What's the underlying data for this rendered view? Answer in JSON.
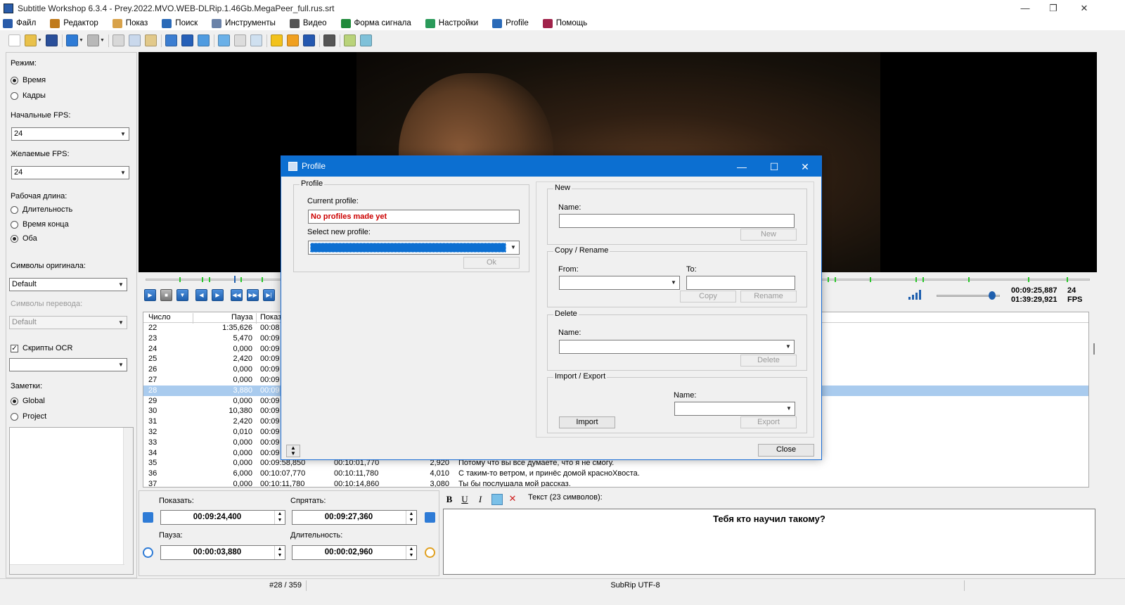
{
  "window": {
    "title": "Subtitle Workshop 6.3.4 - Prey.2022.MVO.WEB-DLRip.1.46Gb.MegaPeer_full.rus.srt",
    "minimize": "—",
    "maximize": "❐",
    "close": "✕"
  },
  "menu": [
    {
      "label": "Файл",
      "icon": "file-icon",
      "color": "#2a5caa"
    },
    {
      "label": "Редактор",
      "icon": "edit-icon",
      "color": "#c07a1a"
    },
    {
      "label": "Показ",
      "icon": "eye-icon",
      "color": "#d8a24a"
    },
    {
      "label": "Поиск",
      "icon": "search-icon",
      "color": "#2a6ab8"
    },
    {
      "label": "Инструменты",
      "icon": "tools-icon",
      "color": "#6a82a8"
    },
    {
      "label": "Видео",
      "icon": "film-icon",
      "color": "#555555"
    },
    {
      "label": "Форма сигнала",
      "icon": "waveform-icon",
      "color": "#1f8a3a"
    },
    {
      "label": "Настройки",
      "icon": "settings-icon",
      "color": "#2a9a5a"
    },
    {
      "label": "Profile",
      "icon": "profile-icon",
      "color": "#2a6ab8"
    },
    {
      "label": "Помощь",
      "icon": "help-book-icon",
      "color": "#a0224a"
    }
  ],
  "left": {
    "mode_label": "Режим:",
    "mode_time": "Время",
    "mode_frames": "Кадры",
    "input_fps_label": "Начальные FPS:",
    "input_fps": "24",
    "target_fps_label": "Желаемые FPS:",
    "target_fps": "24",
    "work_length_label": "Рабочая длина:",
    "wl_duration": "Длительность",
    "wl_end_time": "Время конца",
    "wl_both": "Оба",
    "charset_orig_label": "Символы оригинала:",
    "charset_orig": "Default",
    "charset_trans_label": "Символы перевода:",
    "charset_trans": "Default",
    "ocr_label": "Скрипты OCR",
    "ocr_value": "",
    "notes_label": "Заметки:",
    "notes_global": "Global",
    "notes_project": "Project"
  },
  "player": {
    "current_time": "00:09:25,887",
    "total_time": "01:39:29,921",
    "fps_value": "24",
    "fps_unit": "FPS",
    "volume": 0.88
  },
  "table": {
    "headers": {
      "num": "Число",
      "pause": "Пауза",
      "show": "Показ"
    },
    "rows": [
      {
        "num": "22",
        "pause": "1:35,626",
        "show": "00:08",
        "hide": "",
        "dur": "",
        "text": ""
      },
      {
        "num": "23",
        "pause": "5,470",
        "show": "00:09",
        "hide": "",
        "dur": "",
        "text": ""
      },
      {
        "num": "24",
        "pause": "0,000",
        "show": "00:09",
        "hide": "",
        "dur": "",
        "text": ""
      },
      {
        "num": "25",
        "pause": "2,420",
        "show": "00:09",
        "hide": "",
        "dur": "",
        "text": ""
      },
      {
        "num": "26",
        "pause": "0,000",
        "show": "00:09",
        "hide": "",
        "dur": "",
        "text": ""
      },
      {
        "num": "27",
        "pause": "0,000",
        "show": "00:09",
        "hide": "",
        "dur": "",
        "text": ""
      },
      {
        "num": "28",
        "pause": "3,880",
        "show": "00:09",
        "hide": "",
        "dur": "",
        "text": ""
      },
      {
        "num": "29",
        "pause": "0,000",
        "show": "00:09",
        "hide": "",
        "dur": "",
        "text": ""
      },
      {
        "num": "30",
        "pause": "10,380",
        "show": "00:09",
        "hide": "",
        "dur": "",
        "text": ""
      },
      {
        "num": "31",
        "pause": "2,420",
        "show": "00:09",
        "hide": "",
        "dur": "",
        "text": ""
      },
      {
        "num": "32",
        "pause": "0,010",
        "show": "00:09",
        "hide": "",
        "dur": "",
        "text": ""
      },
      {
        "num": "33",
        "pause": "0,000",
        "show": "00:09",
        "hide": "",
        "dur": "",
        "text": ""
      },
      {
        "num": "34",
        "pause": "0,000",
        "show": "00:09",
        "hide": "",
        "dur": "",
        "text": ""
      },
      {
        "num": "35",
        "pause": "0,000",
        "show": "00:09:58,850",
        "hide": "00:10:01,770",
        "dur": "2,920",
        "text": "Потому что вы все думаете, что я не смогу."
      },
      {
        "num": "36",
        "pause": "6,000",
        "show": "00:10:07,770",
        "hide": "00:10:11,780",
        "dur": "4,010",
        "text": "С таким-то ветром, и принёс домой красноХвоста."
      },
      {
        "num": "37",
        "pause": "0,000",
        "show": "00:10:11,780",
        "hide": "00:10:14,860",
        "dur": "3,080",
        "text": "Ты бы послушала мой рассказ."
      }
    ],
    "selected": 6
  },
  "editor": {
    "show_label": "Показать:",
    "show_value": "00:09:24,400",
    "hide_label": "Спрятать:",
    "hide_value": "00:09:27,360",
    "pause_label": "Пауза:",
    "pause_value": "00:00:03,880",
    "duration_label": "Длительность:",
    "duration_value": "00:00:02,960",
    "text_label": "Текст (23 символов):",
    "text_value": "Тебя кто научил такому?",
    "bold": "B",
    "underline": "U",
    "italic": "I",
    "delete_x": "✕"
  },
  "status": {
    "position": "#28 / 359",
    "format": "SubRip  UTF-8"
  },
  "dialog": {
    "title": "Profile",
    "min": "—",
    "max": "☐",
    "close": "✕",
    "profile_group": "Profile",
    "current_label": "Current profile:",
    "current_value": "No profiles made yet",
    "select_label": "Select new profile:",
    "ok": "Ok",
    "new_group": "New",
    "new_name_label": "Name:",
    "new_btn": "New",
    "copy_group": "Copy / Rename",
    "from_label": "From:",
    "to_label": "To:",
    "copy_btn": "Copy",
    "rename_btn": "Rename",
    "delete_group": "Delete",
    "delete_name_label": "Name:",
    "delete_btn": "Delete",
    "import_group": "Import / Export",
    "ie_name_label": "Name:",
    "import_btn": "Import",
    "export_btn": "Export",
    "close_btn": "Close",
    "error_color": "#cc0000",
    "accent_color": "#0c6fd1"
  }
}
